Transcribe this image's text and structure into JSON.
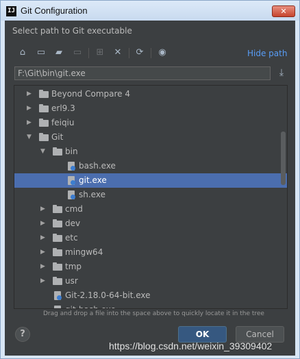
{
  "window": {
    "title": "Git Configuration",
    "app_icon": "IJ",
    "close_icon": "✕"
  },
  "dialog": {
    "subtitle": "Select path to Git executable",
    "hide_path": "Hide path",
    "path_value": "F:\\Git\\bin\\git.exe",
    "hint": "Drag and drop a file into the space above to quickly locate it in the tree"
  },
  "toolbar": [
    {
      "icon": "home-icon",
      "glyph": "⌂"
    },
    {
      "icon": "desktop-icon",
      "glyph": "▭"
    },
    {
      "icon": "new-folder-icon",
      "glyph": "▰"
    },
    {
      "icon": "new-file-icon",
      "glyph": "▭"
    },
    {
      "icon": "delete-icon",
      "glyph": "✕"
    },
    {
      "icon": "refresh-icon",
      "glyph": "⟳"
    },
    {
      "icon": "show-hidden-icon",
      "glyph": "◉"
    }
  ],
  "tree": [
    {
      "label": "Beyond Compare 4",
      "type": "folder",
      "level": 1,
      "arrow": "▶"
    },
    {
      "label": "erl9.3",
      "type": "folder",
      "level": 1,
      "arrow": "▶"
    },
    {
      "label": "feiqiu",
      "type": "folder",
      "level": 1,
      "arrow": "▶"
    },
    {
      "label": "Git",
      "type": "folder",
      "level": 1,
      "arrow": "▼"
    },
    {
      "label": "bin",
      "type": "folder",
      "level": 2,
      "arrow": "▼"
    },
    {
      "label": "bash.exe",
      "type": "file",
      "level": 3,
      "arrow": ""
    },
    {
      "label": "git.exe",
      "type": "file",
      "level": 3,
      "arrow": "",
      "selected": true
    },
    {
      "label": "sh.exe",
      "type": "file",
      "level": 3,
      "arrow": ""
    },
    {
      "label": "cmd",
      "type": "folder",
      "level": 2,
      "arrow": "▶"
    },
    {
      "label": "dev",
      "type": "folder",
      "level": 2,
      "arrow": "▶"
    },
    {
      "label": "etc",
      "type": "folder",
      "level": 2,
      "arrow": "▶"
    },
    {
      "label": "mingw64",
      "type": "folder",
      "level": 2,
      "arrow": "▶"
    },
    {
      "label": "tmp",
      "type": "folder",
      "level": 2,
      "arrow": "▶"
    },
    {
      "label": "usr",
      "type": "folder",
      "level": 2,
      "arrow": "▶"
    },
    {
      "label": "Git-2.18.0-64-bit.exe",
      "type": "file",
      "level": 2,
      "arrow": ""
    },
    {
      "label": "git-bash.exe",
      "type": "file",
      "level": 2,
      "arrow": ""
    }
  ],
  "buttons": {
    "help": "?",
    "ok": "OK",
    "cancel": "Cancel"
  },
  "watermark": "https://blog.csdn.net/weixin_39309402",
  "colors": {
    "accent": "#4b6eaf",
    "link": "#589df6",
    "background": "#3c3f41"
  }
}
